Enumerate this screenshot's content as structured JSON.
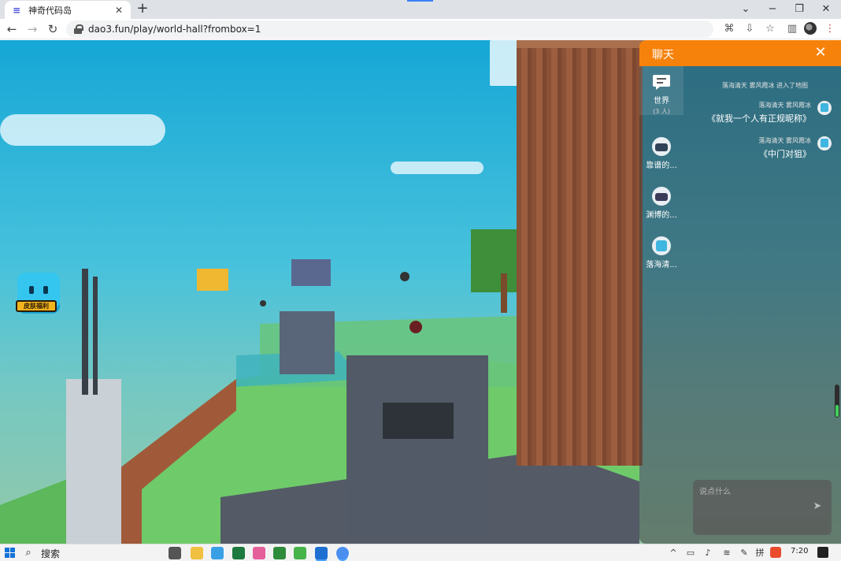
{
  "browser": {
    "tab_title": "神奇代码岛",
    "tab_favicon": "≡",
    "new_tab_glyph": "+",
    "close_glyph": "✕",
    "url": "dao3.fun/play/world-hall?frombox=1",
    "controls": {
      "dropdown": "⌄",
      "minimize": "−",
      "restore": "❐",
      "close": "✕"
    },
    "nav": {
      "back": "←",
      "forward": "→",
      "reload": "↻"
    },
    "toolbar_icons": [
      "translate-icon",
      "install-icon",
      "star-icon",
      "sidebar-icon",
      "profile-avatar",
      "menu-icon"
    ],
    "toolbar_glyphs": {
      "translate": "⌘",
      "install": "⇩",
      "star": "☆",
      "sidebar": "▥",
      "menu": "⋮"
    }
  },
  "game": {
    "skin_badge_label": "皮肤福利"
  },
  "chat": {
    "title": "聊天",
    "close_glyph": "✕",
    "channels": [
      {
        "name": "世界",
        "count": "(3 人)",
        "icon": "chat-bubble-icon",
        "active": true
      },
      {
        "name": "靠谱的...",
        "icon": "avatar"
      },
      {
        "name": "渊博的...",
        "icon": "avatar"
      },
      {
        "name": "落海清...",
        "icon": "avatar"
      }
    ],
    "system_message": "落海清天 雾风霞冰 进入了地图",
    "messages": [
      {
        "sender": "落海清天 雾风霞冰",
        "text": "《就我一个人有正规昵称》"
      },
      {
        "sender": "落海清天 雾风霞冰",
        "text": "《中门对狙》"
      }
    ],
    "input_placeholder": "说点什么",
    "send_glyph": "➤"
  },
  "volume": {
    "level": 0.38
  },
  "taskbar": {
    "search_label": "搜索",
    "search_glyph": "⌕",
    "time": "7:20",
    "tray_glyphs": {
      "chevron": "^",
      "battery": "▭",
      "speaker": "♪",
      "wifi": "≋",
      "pen": "✎",
      "ime": "拼"
    }
  },
  "colors": {
    "chat_header": "#f6820c",
    "sky_top": "#16a7d6",
    "grass": "#6fcb6a",
    "wall": "#8a5136"
  }
}
